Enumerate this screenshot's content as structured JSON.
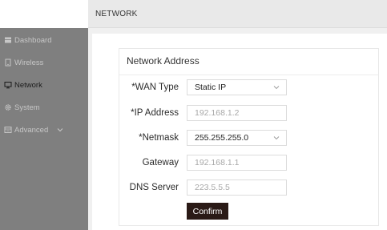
{
  "header": {
    "title": "NETWORK"
  },
  "sidebar": {
    "items": [
      {
        "label": "Dashboard",
        "icon": "dashboard-icon",
        "active": false
      },
      {
        "label": "Wireless",
        "icon": "wireless-icon",
        "active": false
      },
      {
        "label": "Network",
        "icon": "network-icon",
        "active": true
      },
      {
        "label": "System",
        "icon": "gear-icon",
        "active": false
      },
      {
        "label": "Advanced",
        "icon": "advanced-icon",
        "active": false,
        "expandable": true
      }
    ]
  },
  "section": {
    "title": "Network Address"
  },
  "form": {
    "wan_type": {
      "label": "*WAN Type",
      "value": "Static IP"
    },
    "ip_address": {
      "label": "*IP Address",
      "placeholder": "192.168.1.2"
    },
    "netmask": {
      "label": "*Netmask",
      "value": "255.255.255.0"
    },
    "gateway": {
      "label": "Gateway",
      "placeholder": "192.168.1.1"
    },
    "dns_server": {
      "label": "DNS Server",
      "placeholder": "223.5.5.5"
    },
    "confirm_label": "Confirm"
  },
  "colors": {
    "sidebar_bg": "#7f7f7f",
    "sidebar_text": "#c7c7c7",
    "sidebar_active_text": "#1b1b1b",
    "topbar_bg": "#e9e9e9",
    "button_bg": "#2a1a16"
  }
}
